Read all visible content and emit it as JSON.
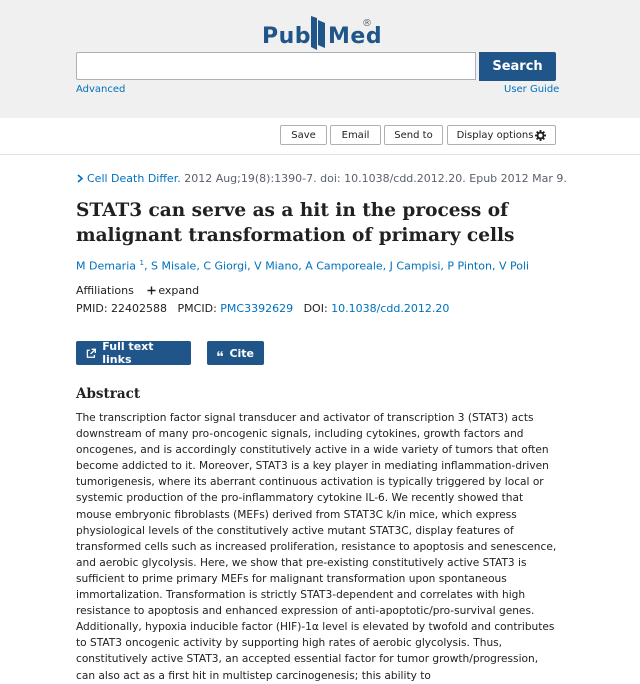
{
  "header": {
    "logo_pub": "Pub",
    "logo_med": "Med",
    "logo_reg": "®",
    "search_placeholder": "",
    "search_label": "Search",
    "advanced_label": "Advanced",
    "user_guide_label": "User Guide",
    "brand_color": "#20558a"
  },
  "actions": {
    "save": "Save",
    "email": "Email",
    "send_to": "Send to",
    "display_options": "Display options"
  },
  "article": {
    "journal_link": "Cell Death Differ.",
    "citation": " 2012 Aug;19(8):1390-7. doi: 10.1038/cdd.2012.20. Epub 2012 Mar 9.",
    "title": "STAT3 can serve as a hit in the process of malignant transformation of primary cells",
    "authors": [
      {
        "name": "M Demaria",
        "sup": "1"
      },
      {
        "name": "S Misale"
      },
      {
        "name": "C Giorgi"
      },
      {
        "name": "V Miano"
      },
      {
        "name": "A Camporeale"
      },
      {
        "name": "J Campisi"
      },
      {
        "name": "P Pinton"
      },
      {
        "name": "V Poli"
      }
    ],
    "affiliations_label": "Affiliations",
    "expand_label": "expand",
    "pmid_label": "PMID: ",
    "pmid": "22402588",
    "pmcid_label": "PMCID: ",
    "pmcid": "PMC3392629",
    "doi_label": "DOI: ",
    "doi": "10.1038/cdd.2012.20",
    "full_text_label": "Full text links",
    "cite_label": "Cite",
    "abstract_heading": "Abstract",
    "abstract": "The transcription factor signal transducer and activator of transcription 3 (STAT3) acts downstream of many pro-oncogenic signals, including cytokines, growth factors and oncogenes, and is accordingly constitutively active in a wide variety of tumors that often become addicted to it. Moreover, STAT3 is a key player in mediating inflammation-driven tumorigenesis, where its aberrant continuous activation is typically triggered by local or systemic production of the pro-inflammatory cytokine IL-6. We recently showed that mouse embryonic fibroblasts (MEFs) derived from STAT3C k/in mice, which express physiological levels of the constitutively active mutant STAT3C, display features of transformed cells such as increased proliferation, resistance to apoptosis and senescence, and aerobic glycolysis. Here, we show that pre-existing constitutively active STAT3 is sufficient to prime primary MEFs for malignant transformation upon spontaneous immortalization. Transformation is strictly STAT3-dependent and correlates with high resistance to apoptosis and enhanced expression of anti-apoptotic/pro-survival genes. Additionally, hypoxia inducible factor (HIF)-1α level is elevated by twofold and contributes to STAT3 oncogenic activity by supporting high rates of aerobic glycolysis. Thus, constitutively active STAT3, an accepted essential factor for tumor growth/progression, can also act as a first hit in multistep carcinogenesis; this ability to"
  }
}
